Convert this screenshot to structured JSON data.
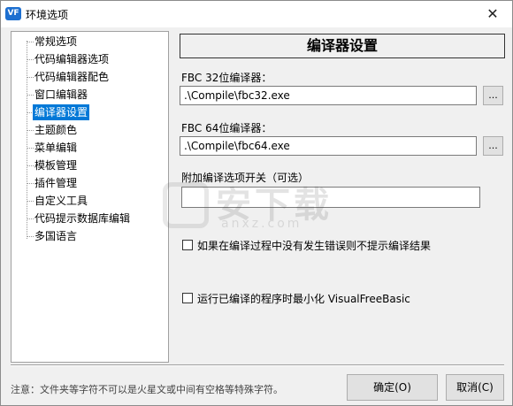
{
  "window": {
    "title": "环境选项",
    "app_icon": "vf-app-icon",
    "close_glyph": "✕"
  },
  "tree": {
    "items": [
      {
        "label": "常规选项",
        "selected": false
      },
      {
        "label": "代码编辑器选项",
        "selected": false
      },
      {
        "label": "代码编辑器配色",
        "selected": false
      },
      {
        "label": "窗口编辑器",
        "selected": false
      },
      {
        "label": "编译器设置",
        "selected": true
      },
      {
        "label": "主题颜色",
        "selected": false
      },
      {
        "label": "菜单编辑",
        "selected": false
      },
      {
        "label": "模板管理",
        "selected": false
      },
      {
        "label": "插件管理",
        "selected": false
      },
      {
        "label": "自定义工具",
        "selected": false
      },
      {
        "label": "代码提示数据库编辑",
        "selected": false
      },
      {
        "label": "多国语言",
        "selected": false
      }
    ]
  },
  "panel": {
    "header": "编译器设置",
    "fbc32_label": "FBC 32位编译器：",
    "fbc32_value": ".\\Compile\\fbc32.exe",
    "fbc64_label": "FBC 64位编译器：",
    "fbc64_value": ".\\Compile\\fbc64.exe",
    "browse_label": "...",
    "extra_label": "附加编译选项开关（可选）",
    "extra_value": "",
    "check_no_prompt": {
      "label": "如果在编译过程中没有发生错误则不提示编译结果",
      "checked": false
    },
    "check_minimize": {
      "label": "运行已编译的程序时最小化 VisualFreeBasic",
      "checked": false
    }
  },
  "footer": {
    "note": "注意：文件夹等字符不可以是火星文或中间有空格等特殊字符。",
    "ok_label": "确定(O)",
    "cancel_label": "取消(C)"
  },
  "watermark": {
    "text": "安下载",
    "sub": "anxz.com"
  },
  "colors": {
    "selection": "#0078d7",
    "app_icon": "#1d6fd0"
  }
}
